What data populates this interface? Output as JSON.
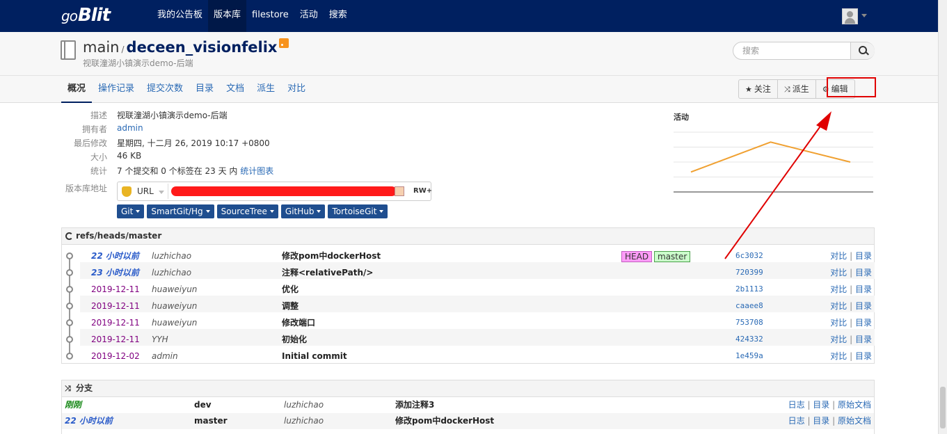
{
  "app": {
    "logo_prefix": "go",
    "logo_text": "Blit"
  },
  "nav": {
    "items": [
      {
        "label": "我的公告板"
      },
      {
        "label": "版本库",
        "active": true
      },
      {
        "label": "filestore"
      },
      {
        "label": "活动"
      },
      {
        "label": "搜索"
      }
    ]
  },
  "repo": {
    "project": "main",
    "name": "deceen_visionfelix",
    "subtitle": "视联潼湖小镇演示demo-后端"
  },
  "search": {
    "placeholder": "搜索"
  },
  "tabs": [
    {
      "label": "概况",
      "active": true
    },
    {
      "label": "操作记录"
    },
    {
      "label": "提交次数"
    },
    {
      "label": "目录"
    },
    {
      "label": "文档"
    },
    {
      "label": "派生"
    },
    {
      "label": "对比"
    }
  ],
  "actions": {
    "watch": "关注",
    "fork": "派生",
    "edit": "编辑"
  },
  "summary": {
    "description_label": "描述",
    "description": "视联潼湖小镇演示demo-后端",
    "owner_label": "拥有者",
    "owner": "admin",
    "last_modified_label": "最后修改",
    "last_modified": "星期四, 十二月 26, 2019 10:17 +0800",
    "size_label": "大小",
    "size": "46 KB",
    "stats_label": "统计",
    "stats": "7 个提交和 0 个标签在 23 天 内",
    "stats_link": "统计图表",
    "url_label": "版本库地址",
    "url_proto": "URL",
    "access": "RW+"
  },
  "clone_tools": [
    {
      "label": "Git"
    },
    {
      "label": "SmartGit/Hg"
    },
    {
      "label": "SourceTree"
    },
    {
      "label": "GitHub"
    },
    {
      "label": "TortoiseGit"
    }
  ],
  "activity": {
    "title": "活动",
    "chart_data": {
      "type": "line",
      "values": [
        2,
        5,
        3
      ],
      "ylim": [
        0,
        6
      ],
      "grid": true,
      "color": "#f0a030"
    }
  },
  "commits": {
    "ref": "refs/heads/master",
    "rows": [
      {
        "date": "22 小时以前",
        "recent": true,
        "author": "luzhichao",
        "message": "修改pom中dockerHost",
        "refs": [
          "HEAD",
          "master"
        ],
        "sha": "6c3032",
        "links": [
          "对比",
          "目录"
        ]
      },
      {
        "date": "23 小时以前",
        "recent": true,
        "author": "luzhichao",
        "message": "注释<relativePath/>",
        "refs": [],
        "sha": "720399",
        "links": [
          "对比",
          "目录"
        ]
      },
      {
        "date": "2019-12-11",
        "recent": false,
        "author": "huaweiyun",
        "message": "优化",
        "refs": [],
        "sha": "2b1113",
        "links": [
          "对比",
          "目录"
        ]
      },
      {
        "date": "2019-12-11",
        "recent": false,
        "author": "huaweiyun",
        "message": "调整",
        "refs": [],
        "sha": "caaee8",
        "links": [
          "对比",
          "目录"
        ]
      },
      {
        "date": "2019-12-11",
        "recent": false,
        "author": "huaweiyun",
        "message": "修改端口",
        "refs": [],
        "sha": "753708",
        "links": [
          "对比",
          "目录"
        ]
      },
      {
        "date": "2019-12-11",
        "recent": false,
        "author": "YYH",
        "message": "初始化",
        "refs": [],
        "sha": "424332",
        "links": [
          "对比",
          "目录"
        ]
      },
      {
        "date": "2019-12-02",
        "recent": false,
        "author": "admin",
        "message": "Initial commit",
        "refs": [],
        "sha": "1e459a",
        "links": [
          "对比",
          "目录"
        ]
      }
    ]
  },
  "branches": {
    "title": "分支",
    "rows": [
      {
        "when": "刚刚",
        "color": "green",
        "name": "dev",
        "author": "luzhichao",
        "message": "添加注释3",
        "links": [
          "日志",
          "目录",
          "原始文档"
        ]
      },
      {
        "when": "22 小时以前",
        "color": "blue",
        "name": "master",
        "author": "luzhichao",
        "message": "修改pom中dockerHost",
        "links": [
          "日志",
          "目录",
          "原始文档"
        ]
      }
    ]
  },
  "colors": {
    "nav_bg": "#002060",
    "accent": "#2a6ab5",
    "highlight": "#e00000"
  }
}
